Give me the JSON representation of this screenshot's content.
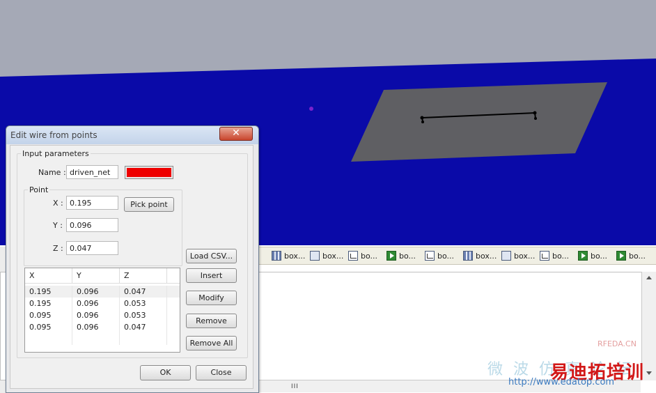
{
  "dialog": {
    "title": "Edit wire from points",
    "close_glyph": "✕",
    "input_group_label": "Input parameters",
    "name_label": "Name :",
    "name_value": "driven_net",
    "color": "#ee0000",
    "point_group_label": "Point",
    "x_label": "X :",
    "x_value": "0.195",
    "y_label": "Y :",
    "y_value": "0.096",
    "z_label": "Z :",
    "z_value": "0.047",
    "pick_point": "Pick point",
    "buttons": {
      "load_csv": "Load CSV...",
      "insert": "Insert",
      "modify": "Modify",
      "remove": "Remove",
      "remove_all": "Remove All",
      "ok": "OK",
      "close": "Close"
    },
    "table": {
      "columns": [
        "X",
        "Y",
        "Z"
      ],
      "rows": [
        [
          "0.195",
          "0.096",
          "0.047"
        ],
        [
          "0.195",
          "0.096",
          "0.053"
        ],
        [
          "0.095",
          "0.096",
          "0.053"
        ],
        [
          "0.095",
          "0.096",
          "0.047"
        ]
      ]
    }
  },
  "taskbar": {
    "items": [
      {
        "label": "box...",
        "icon": "grid-icon"
      },
      {
        "label": "box...",
        "icon": "window-icon"
      },
      {
        "label": "bo...",
        "icon": "chart-icon"
      },
      {
        "label": "bo...",
        "icon": "play-icon"
      },
      {
        "label": "bo...",
        "icon": "chart-icon"
      },
      {
        "label": "box...",
        "icon": "grid-icon"
      },
      {
        "label": "box...",
        "icon": "window-icon"
      },
      {
        "label": "bo...",
        "icon": "chart-icon"
      },
      {
        "label": "bo...",
        "icon": "play-icon"
      },
      {
        "label": "bo...",
        "icon": "play-icon"
      }
    ]
  },
  "scrollbar_grip": "III",
  "watermark": {
    "line1": "RFEDA.CN",
    "line2": "易迪拓培训",
    "line3": "http://www.edatop.com",
    "line4": "微 波 仿 真 论 坛"
  },
  "colors": {
    "sky": "#a5a9b6",
    "ground": "#0a0aa8",
    "plate": "#5f5f63",
    "wire": "#000000",
    "dot": "#7a22cc"
  }
}
